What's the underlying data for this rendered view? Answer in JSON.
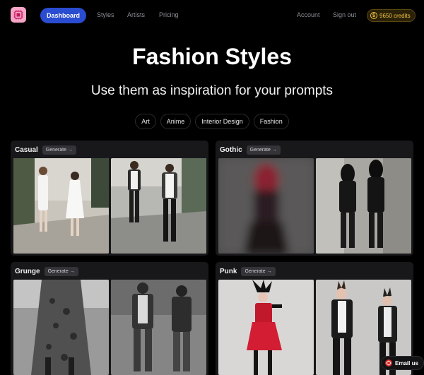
{
  "nav": {
    "dashboard": "Dashboard",
    "styles": "Styles",
    "artists": "Artists",
    "pricing": "Pricing",
    "account": "Account",
    "signout": "Sign out",
    "credits": "9650 credits"
  },
  "hero": {
    "title": "Fashion Styles",
    "subtitle": "Use them as inspiration for your prompts"
  },
  "categories": [
    "Art",
    "Anime",
    "Interior Design",
    "Fashion"
  ],
  "cards": [
    {
      "name": "Casual",
      "generate": "Generate"
    },
    {
      "name": "Gothic",
      "generate": "Generate"
    },
    {
      "name": "Grunge",
      "generate": "Generate"
    },
    {
      "name": "Punk",
      "generate": "Generate"
    }
  ],
  "footer": {
    "email": "Email us"
  },
  "colors": {
    "accent": "#2a4cd1",
    "credits": "#f5c542",
    "card": "#18181b"
  }
}
